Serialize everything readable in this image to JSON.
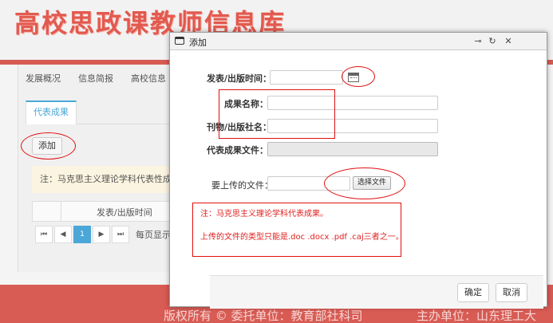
{
  "background": {
    "site_title": "高校思政课教师信息库",
    "nav": [
      "发展概况",
      "信息简报",
      "高校信息"
    ],
    "active_tab": "代表成果",
    "add_button": "添加",
    "note": "注：马克思主义理论学科代表性成果",
    "table_header": "发表/出版时间",
    "pager": {
      "first": "⏮",
      "prev": "◀",
      "current": "1",
      "next": "▶",
      "last": "⏭",
      "per_page": "每页显示"
    },
    "footer_copyright": "版权所有 © 委托单位：教育部社科司",
    "footer_host": "主办单位：山东理工大"
  },
  "dialog": {
    "title": "添加",
    "controls": {
      "pin": "⊸",
      "refresh": "↻",
      "close": "✕"
    },
    "fields": {
      "publish_time_label": "发表/出版时间：",
      "result_name_label": "成果名称：",
      "journal_label": "刊物/出版社名：",
      "file_label": "代表成果文件：",
      "upload_label": "要上传的文件：",
      "choose_file": "选择文件"
    },
    "note_line1": "注：马克思主义理论学科代表成果。",
    "note_line2": "上传的文件的类型只能是.doc .docx .pdf .caj三者之一。",
    "confirm": "确定",
    "cancel": "取消"
  },
  "colors": {
    "brand_red": "#e25a4f",
    "accent_blue": "#4aa7d8",
    "annotation_red": "#e01010"
  }
}
